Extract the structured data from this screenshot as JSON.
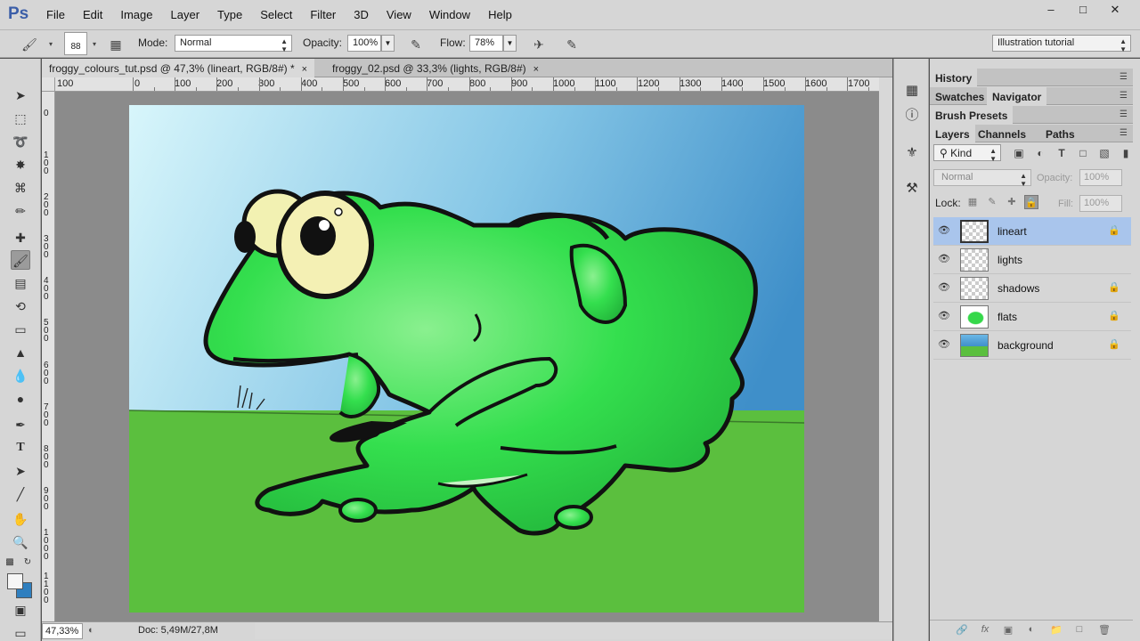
{
  "app": {
    "logo": "Ps"
  },
  "menu": [
    "File",
    "Edit",
    "Image",
    "Layer",
    "Type",
    "Select",
    "Filter",
    "3D",
    "View",
    "Window",
    "Help"
  ],
  "window_controls": {
    "minimize": "–",
    "maximize": "□",
    "close": "✕"
  },
  "options": {
    "brush_size": "88",
    "mode_label": "Mode:",
    "mode_value": "Normal",
    "opacity_label": "Opacity:",
    "opacity_value": "100%",
    "flow_label": "Flow:",
    "flow_value": "78%",
    "workspace": "Illustration tutorial"
  },
  "doc_tabs": [
    {
      "title": "froggy_colours_tut.psd @ 47,3% (lineart, RGB/8#) *",
      "close": "×"
    },
    {
      "title": "froggy_02.psd @ 33,3% (lights, RGB/8#)",
      "close": "×"
    }
  ],
  "ruler_top": [
    "100",
    "0",
    "100",
    "200",
    "300",
    "400",
    "500",
    "600",
    "700",
    "800",
    "900",
    "1000",
    "1100",
    "1200",
    "1300",
    "1400",
    "1500",
    "1600",
    "1700"
  ],
  "ruler_left": [
    "0",
    "1\n0\n0",
    "2\n0\n0",
    "3\n0\n0",
    "4\n0\n0",
    "5\n0\n0",
    "6\n0\n0",
    "7\n0\n0",
    "8\n0\n0",
    "9\n0\n0",
    "1\n0\n0\n0",
    "1\n1\n0\n0"
  ],
  "status": {
    "zoom": "47,33%",
    "doc_info": "Doc: 5,49M/27,8M",
    "arrow": "▶"
  },
  "panels": {
    "history": "History",
    "swatches": "Swatches",
    "navigator": "Navigator",
    "brush_presets": "Brush Presets",
    "layers_tab": "Layers",
    "channels_tab": "Channels",
    "paths_tab": "Paths",
    "filter_kind": "Kind",
    "blend_mode": "Normal",
    "opacity_label": "Opacity:",
    "opacity_value": "100%",
    "lock_label": "Lock:",
    "fill_label": "Fill:",
    "fill_value": "100%"
  },
  "layers": [
    {
      "name": "lineart",
      "locked": true,
      "active": true
    },
    {
      "name": "lights",
      "locked": false,
      "active": false
    },
    {
      "name": "shadows",
      "locked": true,
      "active": false
    },
    {
      "name": "flats",
      "locked": true,
      "active": false
    },
    {
      "name": "background",
      "locked": true,
      "active": false
    }
  ],
  "colors": {
    "foreground": "#f6f6f6",
    "background": "#2f7fbf",
    "sky_top": "#d8f6fb",
    "sky_bottom": "#3f8fc9",
    "grass": "#5bbf3e",
    "frog": "#34df4e"
  }
}
